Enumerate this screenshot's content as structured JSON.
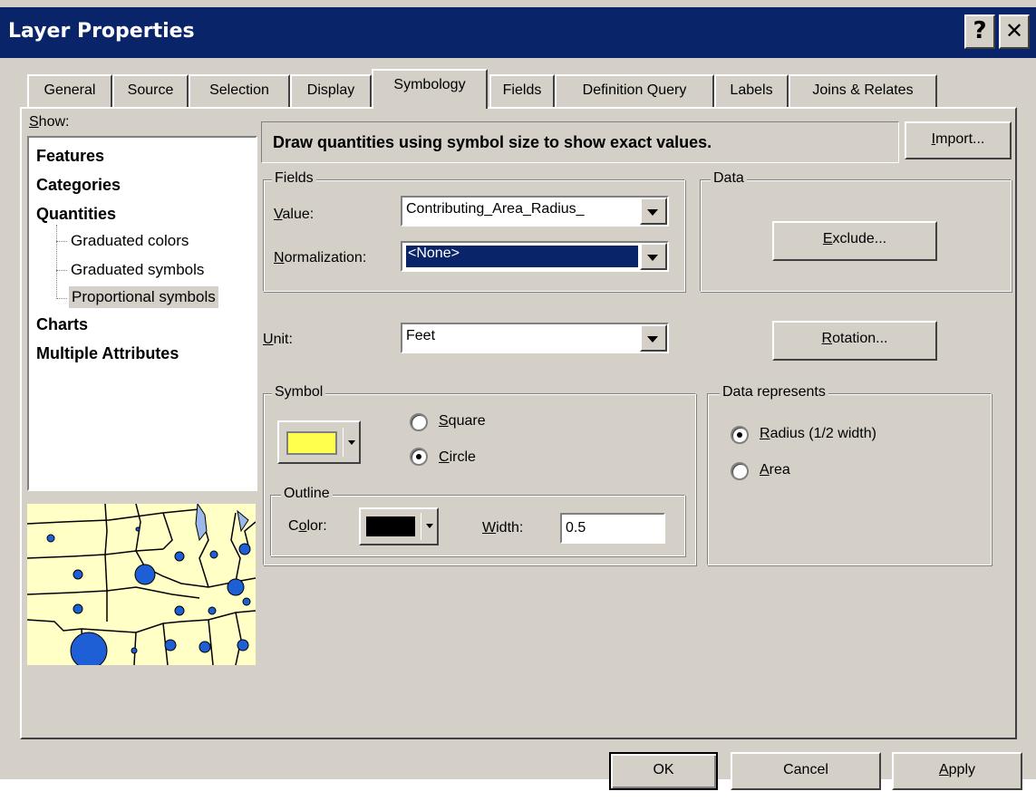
{
  "window": {
    "title": "Layer Properties",
    "help_button": "?",
    "close_button": "✕"
  },
  "tabs": [
    {
      "label": "General"
    },
    {
      "label": "Source"
    },
    {
      "label": "Selection"
    },
    {
      "label": "Display"
    },
    {
      "label": "Symbology",
      "active": true
    },
    {
      "label": "Fields"
    },
    {
      "label": "Definition Query"
    },
    {
      "label": "Labels"
    },
    {
      "label": "Joins & Relates"
    }
  ],
  "show": {
    "label": "Show:",
    "items": [
      {
        "label": "Features",
        "bold": true
      },
      {
        "label": "Categories",
        "bold": true
      },
      {
        "label": "Quantities",
        "bold": true
      },
      {
        "label": "Graduated colors"
      },
      {
        "label": "Graduated symbols"
      },
      {
        "label": "Proportional symbols",
        "selected": true
      },
      {
        "label": "Charts",
        "bold": true
      },
      {
        "label": "Multiple Attributes",
        "bold": true
      }
    ]
  },
  "description": "Draw quantities using symbol size to show exact values.",
  "import_button": "Import...",
  "fields": {
    "title": "Fields",
    "value_label": "Value:",
    "value": "Contributing_Area_Radius_",
    "normalization_label": "Normalization:",
    "normalization": "<None>"
  },
  "data": {
    "title": "Data",
    "exclude_button": "Exclude..."
  },
  "unit": {
    "label": "Unit:",
    "value": "Feet"
  },
  "rotation_button": "Rotation...",
  "symbol": {
    "title": "Symbol",
    "fill_color": "#ffff4d",
    "square_label": "Square",
    "circle_label": "Circle",
    "selected_shape": "circle"
  },
  "outline": {
    "title": "Outline",
    "color_label": "Color:",
    "color": "#000000",
    "width_label": "Width:",
    "width": "0.5"
  },
  "data_represents": {
    "title": "Data represents",
    "radius_label": "Radius (1/2 width)",
    "area_label": "Area",
    "selected": "radius"
  },
  "buttons": {
    "ok": "OK",
    "cancel": "Cancel",
    "apply": "Apply"
  },
  "colors": {
    "title_bar": "#0a246a",
    "dialog_face": "#d4d0c8",
    "selection": "#0a246a",
    "map_fill": "#ffffc6",
    "map_symbol": "#1f5fd6",
    "map_water": "#9cb8e8"
  }
}
